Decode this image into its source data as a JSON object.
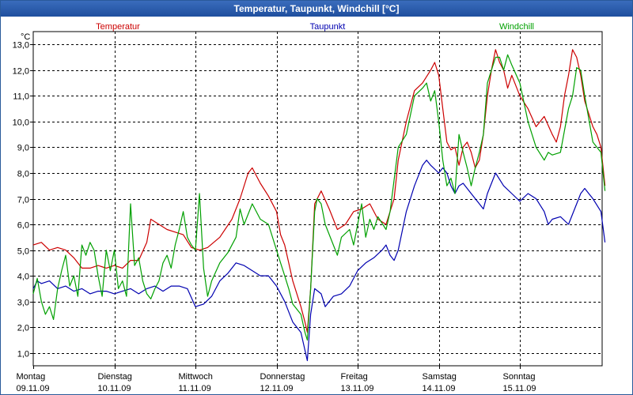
{
  "window": {
    "title": "Temperatur, Taupunkt, Windchill [°C]"
  },
  "chart_data": {
    "type": "line",
    "unit_label": "°C",
    "ylim": [
      0.5,
      13.5
    ],
    "xlim": [
      0,
      7.05
    ],
    "grid": true,
    "y_ticks": [
      {
        "value": 1,
        "label": "1,0"
      },
      {
        "value": 2,
        "label": "2,0"
      },
      {
        "value": 3,
        "label": "3,0"
      },
      {
        "value": 4,
        "label": "4,0"
      },
      {
        "value": 5,
        "label": "5,0"
      },
      {
        "value": 6,
        "label": "6,0"
      },
      {
        "value": 7,
        "label": "7,0"
      },
      {
        "value": 8,
        "label": "8,0"
      },
      {
        "value": 9,
        "label": "9,0"
      },
      {
        "value": 10,
        "label": "10,0"
      },
      {
        "value": 11,
        "label": "11,0"
      },
      {
        "value": 12,
        "label": "12,0"
      },
      {
        "value": 13,
        "label": "13,0"
      }
    ],
    "x_ticks": [
      {
        "value": 0,
        "day": "Montag",
        "date": "09.11.09"
      },
      {
        "value": 1,
        "day": "Dienstag",
        "date": "10.11.09"
      },
      {
        "value": 2,
        "day": "Mittwoch",
        "date": "11.11.09"
      },
      {
        "value": 3,
        "day": "Donnerstag",
        "date": "12.11.09"
      },
      {
        "value": 4,
        "day": "Freitag",
        "date": "13.11.09"
      },
      {
        "value": 5,
        "day": "Samstag",
        "date": "14.11.09"
      },
      {
        "value": 6,
        "day": "Sonntag",
        "date": "15.11.09"
      }
    ],
    "legend_placement": "top",
    "series": [
      {
        "name": "Temperatur",
        "color": "#cc0000",
        "points": [
          [
            0,
            5.2
          ],
          [
            0.1,
            5.3
          ],
          [
            0.2,
            5.0
          ],
          [
            0.3,
            5.1
          ],
          [
            0.4,
            5.0
          ],
          [
            0.5,
            4.7
          ],
          [
            0.6,
            4.3
          ],
          [
            0.7,
            4.3
          ],
          [
            0.8,
            4.4
          ],
          [
            0.9,
            4.3
          ],
          [
            1.0,
            4.4
          ],
          [
            1.1,
            4.3
          ],
          [
            1.2,
            4.6
          ],
          [
            1.3,
            4.6
          ],
          [
            1.4,
            5.3
          ],
          [
            1.45,
            6.2
          ],
          [
            1.55,
            6.0
          ],
          [
            1.65,
            5.8
          ],
          [
            1.75,
            5.7
          ],
          [
            1.85,
            5.6
          ],
          [
            1.95,
            5.1
          ],
          [
            2.05,
            5.0
          ],
          [
            2.15,
            5.1
          ],
          [
            2.3,
            5.5
          ],
          [
            2.45,
            6.2
          ],
          [
            2.55,
            7.0
          ],
          [
            2.65,
            8.0
          ],
          [
            2.7,
            8.2
          ],
          [
            2.8,
            7.6
          ],
          [
            2.9,
            7.1
          ],
          [
            3.0,
            6.5
          ],
          [
            3.05,
            5.6
          ],
          [
            3.1,
            5.2
          ],
          [
            3.15,
            4.5
          ],
          [
            3.2,
            3.8
          ],
          [
            3.3,
            2.8
          ],
          [
            3.35,
            2.2
          ],
          [
            3.38,
            1.8
          ],
          [
            3.42,
            3.5
          ],
          [
            3.47,
            6.8
          ],
          [
            3.55,
            7.3
          ],
          [
            3.65,
            6.6
          ],
          [
            3.75,
            5.8
          ],
          [
            3.85,
            6.0
          ],
          [
            3.95,
            6.5
          ],
          [
            4.05,
            6.6
          ],
          [
            4.15,
            6.8
          ],
          [
            4.25,
            6.2
          ],
          [
            4.35,
            6.0
          ],
          [
            4.45,
            7.0
          ],
          [
            4.5,
            8.5
          ],
          [
            4.6,
            10.0
          ],
          [
            4.7,
            11.2
          ],
          [
            4.8,
            11.5
          ],
          [
            4.9,
            12.0
          ],
          [
            4.95,
            12.3
          ],
          [
            5.0,
            11.8
          ],
          [
            5.05,
            10.5
          ],
          [
            5.1,
            9.2
          ],
          [
            5.15,
            8.9
          ],
          [
            5.2,
            9.0
          ],
          [
            5.25,
            8.3
          ],
          [
            5.3,
            9.0
          ],
          [
            5.35,
            9.2
          ],
          [
            5.4,
            8.8
          ],
          [
            5.45,
            8.2
          ],
          [
            5.5,
            8.5
          ],
          [
            5.55,
            9.5
          ],
          [
            5.6,
            11.0
          ],
          [
            5.65,
            12.0
          ],
          [
            5.7,
            12.8
          ],
          [
            5.75,
            12.3
          ],
          [
            5.8,
            12.0
          ],
          [
            5.85,
            11.3
          ],
          [
            5.9,
            11.8
          ],
          [
            6.0,
            11.0
          ],
          [
            6.1,
            10.5
          ],
          [
            6.2,
            9.8
          ],
          [
            6.3,
            10.2
          ],
          [
            6.4,
            9.5
          ],
          [
            6.45,
            9.2
          ],
          [
            6.5,
            9.8
          ],
          [
            6.55,
            11.0
          ],
          [
            6.6,
            11.8
          ],
          [
            6.65,
            12.8
          ],
          [
            6.7,
            12.5
          ],
          [
            6.75,
            11.8
          ],
          [
            6.8,
            10.8
          ],
          [
            6.9,
            9.8
          ],
          [
            6.95,
            9.5
          ],
          [
            7.0,
            9.0
          ],
          [
            7.05,
            7.5
          ]
        ]
      },
      {
        "name": "Taupunkt",
        "color": "#0000b0",
        "points": [
          [
            0,
            3.5
          ],
          [
            0.05,
            3.8
          ],
          [
            0.1,
            3.7
          ],
          [
            0.2,
            3.8
          ],
          [
            0.3,
            3.5
          ],
          [
            0.4,
            3.6
          ],
          [
            0.5,
            3.4
          ],
          [
            0.6,
            3.5
          ],
          [
            0.7,
            3.3
          ],
          [
            0.8,
            3.4
          ],
          [
            0.9,
            3.4
          ],
          [
            1.0,
            3.3
          ],
          [
            1.1,
            3.4
          ],
          [
            1.2,
            3.5
          ],
          [
            1.3,
            3.3
          ],
          [
            1.4,
            3.5
          ],
          [
            1.5,
            3.6
          ],
          [
            1.6,
            3.4
          ],
          [
            1.7,
            3.6
          ],
          [
            1.8,
            3.6
          ],
          [
            1.9,
            3.5
          ],
          [
            2.0,
            2.8
          ],
          [
            2.1,
            2.9
          ],
          [
            2.2,
            3.2
          ],
          [
            2.3,
            3.8
          ],
          [
            2.4,
            4.1
          ],
          [
            2.5,
            4.5
          ],
          [
            2.6,
            4.4
          ],
          [
            2.7,
            4.2
          ],
          [
            2.8,
            4.0
          ],
          [
            2.9,
            4.0
          ],
          [
            3.0,
            3.6
          ],
          [
            3.1,
            3.0
          ],
          [
            3.2,
            2.2
          ],
          [
            3.3,
            1.8
          ],
          [
            3.38,
            0.7
          ],
          [
            3.42,
            2.5
          ],
          [
            3.47,
            3.5
          ],
          [
            3.55,
            3.3
          ],
          [
            3.6,
            2.8
          ],
          [
            3.7,
            3.2
          ],
          [
            3.8,
            3.3
          ],
          [
            3.9,
            3.6
          ],
          [
            4.0,
            4.2
          ],
          [
            4.1,
            4.5
          ],
          [
            4.2,
            4.7
          ],
          [
            4.3,
            5.0
          ],
          [
            4.35,
            5.2
          ],
          [
            4.4,
            4.8
          ],
          [
            4.45,
            4.6
          ],
          [
            4.5,
            5.0
          ],
          [
            4.6,
            6.5
          ],
          [
            4.7,
            7.5
          ],
          [
            4.8,
            8.3
          ],
          [
            4.85,
            8.5
          ],
          [
            4.9,
            8.3
          ],
          [
            5.0,
            8.0
          ],
          [
            5.05,
            8.2
          ],
          [
            5.1,
            8.0
          ],
          [
            5.15,
            7.5
          ],
          [
            5.2,
            7.2
          ],
          [
            5.25,
            7.5
          ],
          [
            5.3,
            7.6
          ],
          [
            5.4,
            7.2
          ],
          [
            5.5,
            6.8
          ],
          [
            5.55,
            6.6
          ],
          [
            5.6,
            7.2
          ],
          [
            5.7,
            8.0
          ],
          [
            5.8,
            7.5
          ],
          [
            5.9,
            7.2
          ],
          [
            6.0,
            6.9
          ],
          [
            6.1,
            7.2
          ],
          [
            6.2,
            7.0
          ],
          [
            6.3,
            6.5
          ],
          [
            6.35,
            6.0
          ],
          [
            6.4,
            6.2
          ],
          [
            6.5,
            6.3
          ],
          [
            6.6,
            6.0
          ],
          [
            6.7,
            6.8
          ],
          [
            6.75,
            7.2
          ],
          [
            6.8,
            7.4
          ],
          [
            6.85,
            7.2
          ],
          [
            6.9,
            7.0
          ],
          [
            7.0,
            6.5
          ],
          [
            7.05,
            5.3
          ]
        ]
      },
      {
        "name": "Windchill",
        "color": "#00a000",
        "points": [
          [
            0,
            3.3
          ],
          [
            0.05,
            3.9
          ],
          [
            0.1,
            3.0
          ],
          [
            0.15,
            2.5
          ],
          [
            0.2,
            2.8
          ],
          [
            0.25,
            2.3
          ],
          [
            0.3,
            3.5
          ],
          [
            0.35,
            4.2
          ],
          [
            0.4,
            4.8
          ],
          [
            0.45,
            3.6
          ],
          [
            0.5,
            4.0
          ],
          [
            0.55,
            3.2
          ],
          [
            0.6,
            5.2
          ],
          [
            0.65,
            4.8
          ],
          [
            0.7,
            5.3
          ],
          [
            0.75,
            5.0
          ],
          [
            0.8,
            4.0
          ],
          [
            0.85,
            3.2
          ],
          [
            0.9,
            5.0
          ],
          [
            0.95,
            4.2
          ],
          [
            1.0,
            5.0
          ],
          [
            1.05,
            3.5
          ],
          [
            1.1,
            3.8
          ],
          [
            1.15,
            3.2
          ],
          [
            1.2,
            6.8
          ],
          [
            1.25,
            4.4
          ],
          [
            1.3,
            4.7
          ],
          [
            1.35,
            3.8
          ],
          [
            1.4,
            3.3
          ],
          [
            1.45,
            3.1
          ],
          [
            1.5,
            3.5
          ],
          [
            1.55,
            3.8
          ],
          [
            1.6,
            4.5
          ],
          [
            1.65,
            4.8
          ],
          [
            1.7,
            4.3
          ],
          [
            1.75,
            5.2
          ],
          [
            1.8,
            5.8
          ],
          [
            1.85,
            6.5
          ],
          [
            1.9,
            5.5
          ],
          [
            1.95,
            5.2
          ],
          [
            2.0,
            5.0
          ],
          [
            2.05,
            7.2
          ],
          [
            2.1,
            4.3
          ],
          [
            2.15,
            3.2
          ],
          [
            2.2,
            3.8
          ],
          [
            2.3,
            4.5
          ],
          [
            2.4,
            4.9
          ],
          [
            2.5,
            5.5
          ],
          [
            2.55,
            6.6
          ],
          [
            2.6,
            6.0
          ],
          [
            2.7,
            6.8
          ],
          [
            2.8,
            6.2
          ],
          [
            2.9,
            6.0
          ],
          [
            3.0,
            5.0
          ],
          [
            3.05,
            4.5
          ],
          [
            3.1,
            4.0
          ],
          [
            3.15,
            3.5
          ],
          [
            3.2,
            2.9
          ],
          [
            3.3,
            2.5
          ],
          [
            3.35,
            1.8
          ],
          [
            3.38,
            1.5
          ],
          [
            3.42,
            3.5
          ],
          [
            3.47,
            6.5
          ],
          [
            3.5,
            7.0
          ],
          [
            3.55,
            6.8
          ],
          [
            3.6,
            6.0
          ],
          [
            3.7,
            5.2
          ],
          [
            3.75,
            4.8
          ],
          [
            3.8,
            5.5
          ],
          [
            3.9,
            5.8
          ],
          [
            3.95,
            5.2
          ],
          [
            4.05,
            6.8
          ],
          [
            4.1,
            5.5
          ],
          [
            4.15,
            6.2
          ],
          [
            4.2,
            5.8
          ],
          [
            4.25,
            6.3
          ],
          [
            4.35,
            5.8
          ],
          [
            4.4,
            6.5
          ],
          [
            4.5,
            9.0
          ],
          [
            4.6,
            9.5
          ],
          [
            4.7,
            11.0
          ],
          [
            4.8,
            11.3
          ],
          [
            4.85,
            11.5
          ],
          [
            4.9,
            10.8
          ],
          [
            4.95,
            11.2
          ],
          [
            5.0,
            10.0
          ],
          [
            5.05,
            8.5
          ],
          [
            5.1,
            7.5
          ],
          [
            5.15,
            7.8
          ],
          [
            5.2,
            7.2
          ],
          [
            5.25,
            9.5
          ],
          [
            5.3,
            8.8
          ],
          [
            5.35,
            8.2
          ],
          [
            5.4,
            7.5
          ],
          [
            5.45,
            8.2
          ],
          [
            5.5,
            8.8
          ],
          [
            5.55,
            9.5
          ],
          [
            5.6,
            11.5
          ],
          [
            5.65,
            12.0
          ],
          [
            5.7,
            12.5
          ],
          [
            5.75,
            12.5
          ],
          [
            5.8,
            12.0
          ],
          [
            5.85,
            12.6
          ],
          [
            5.9,
            12.2
          ],
          [
            6.0,
            11.5
          ],
          [
            6.1,
            10.0
          ],
          [
            6.2,
            9.0
          ],
          [
            6.3,
            8.5
          ],
          [
            6.35,
            8.8
          ],
          [
            6.4,
            8.7
          ],
          [
            6.5,
            8.8
          ],
          [
            6.6,
            10.5
          ],
          [
            6.65,
            11.0
          ],
          [
            6.7,
            12.1
          ],
          [
            6.75,
            12.0
          ],
          [
            6.8,
            11.0
          ],
          [
            6.9,
            9.2
          ],
          [
            6.95,
            9.0
          ],
          [
            7.0,
            8.8
          ],
          [
            7.05,
            7.3
          ]
        ]
      }
    ]
  }
}
